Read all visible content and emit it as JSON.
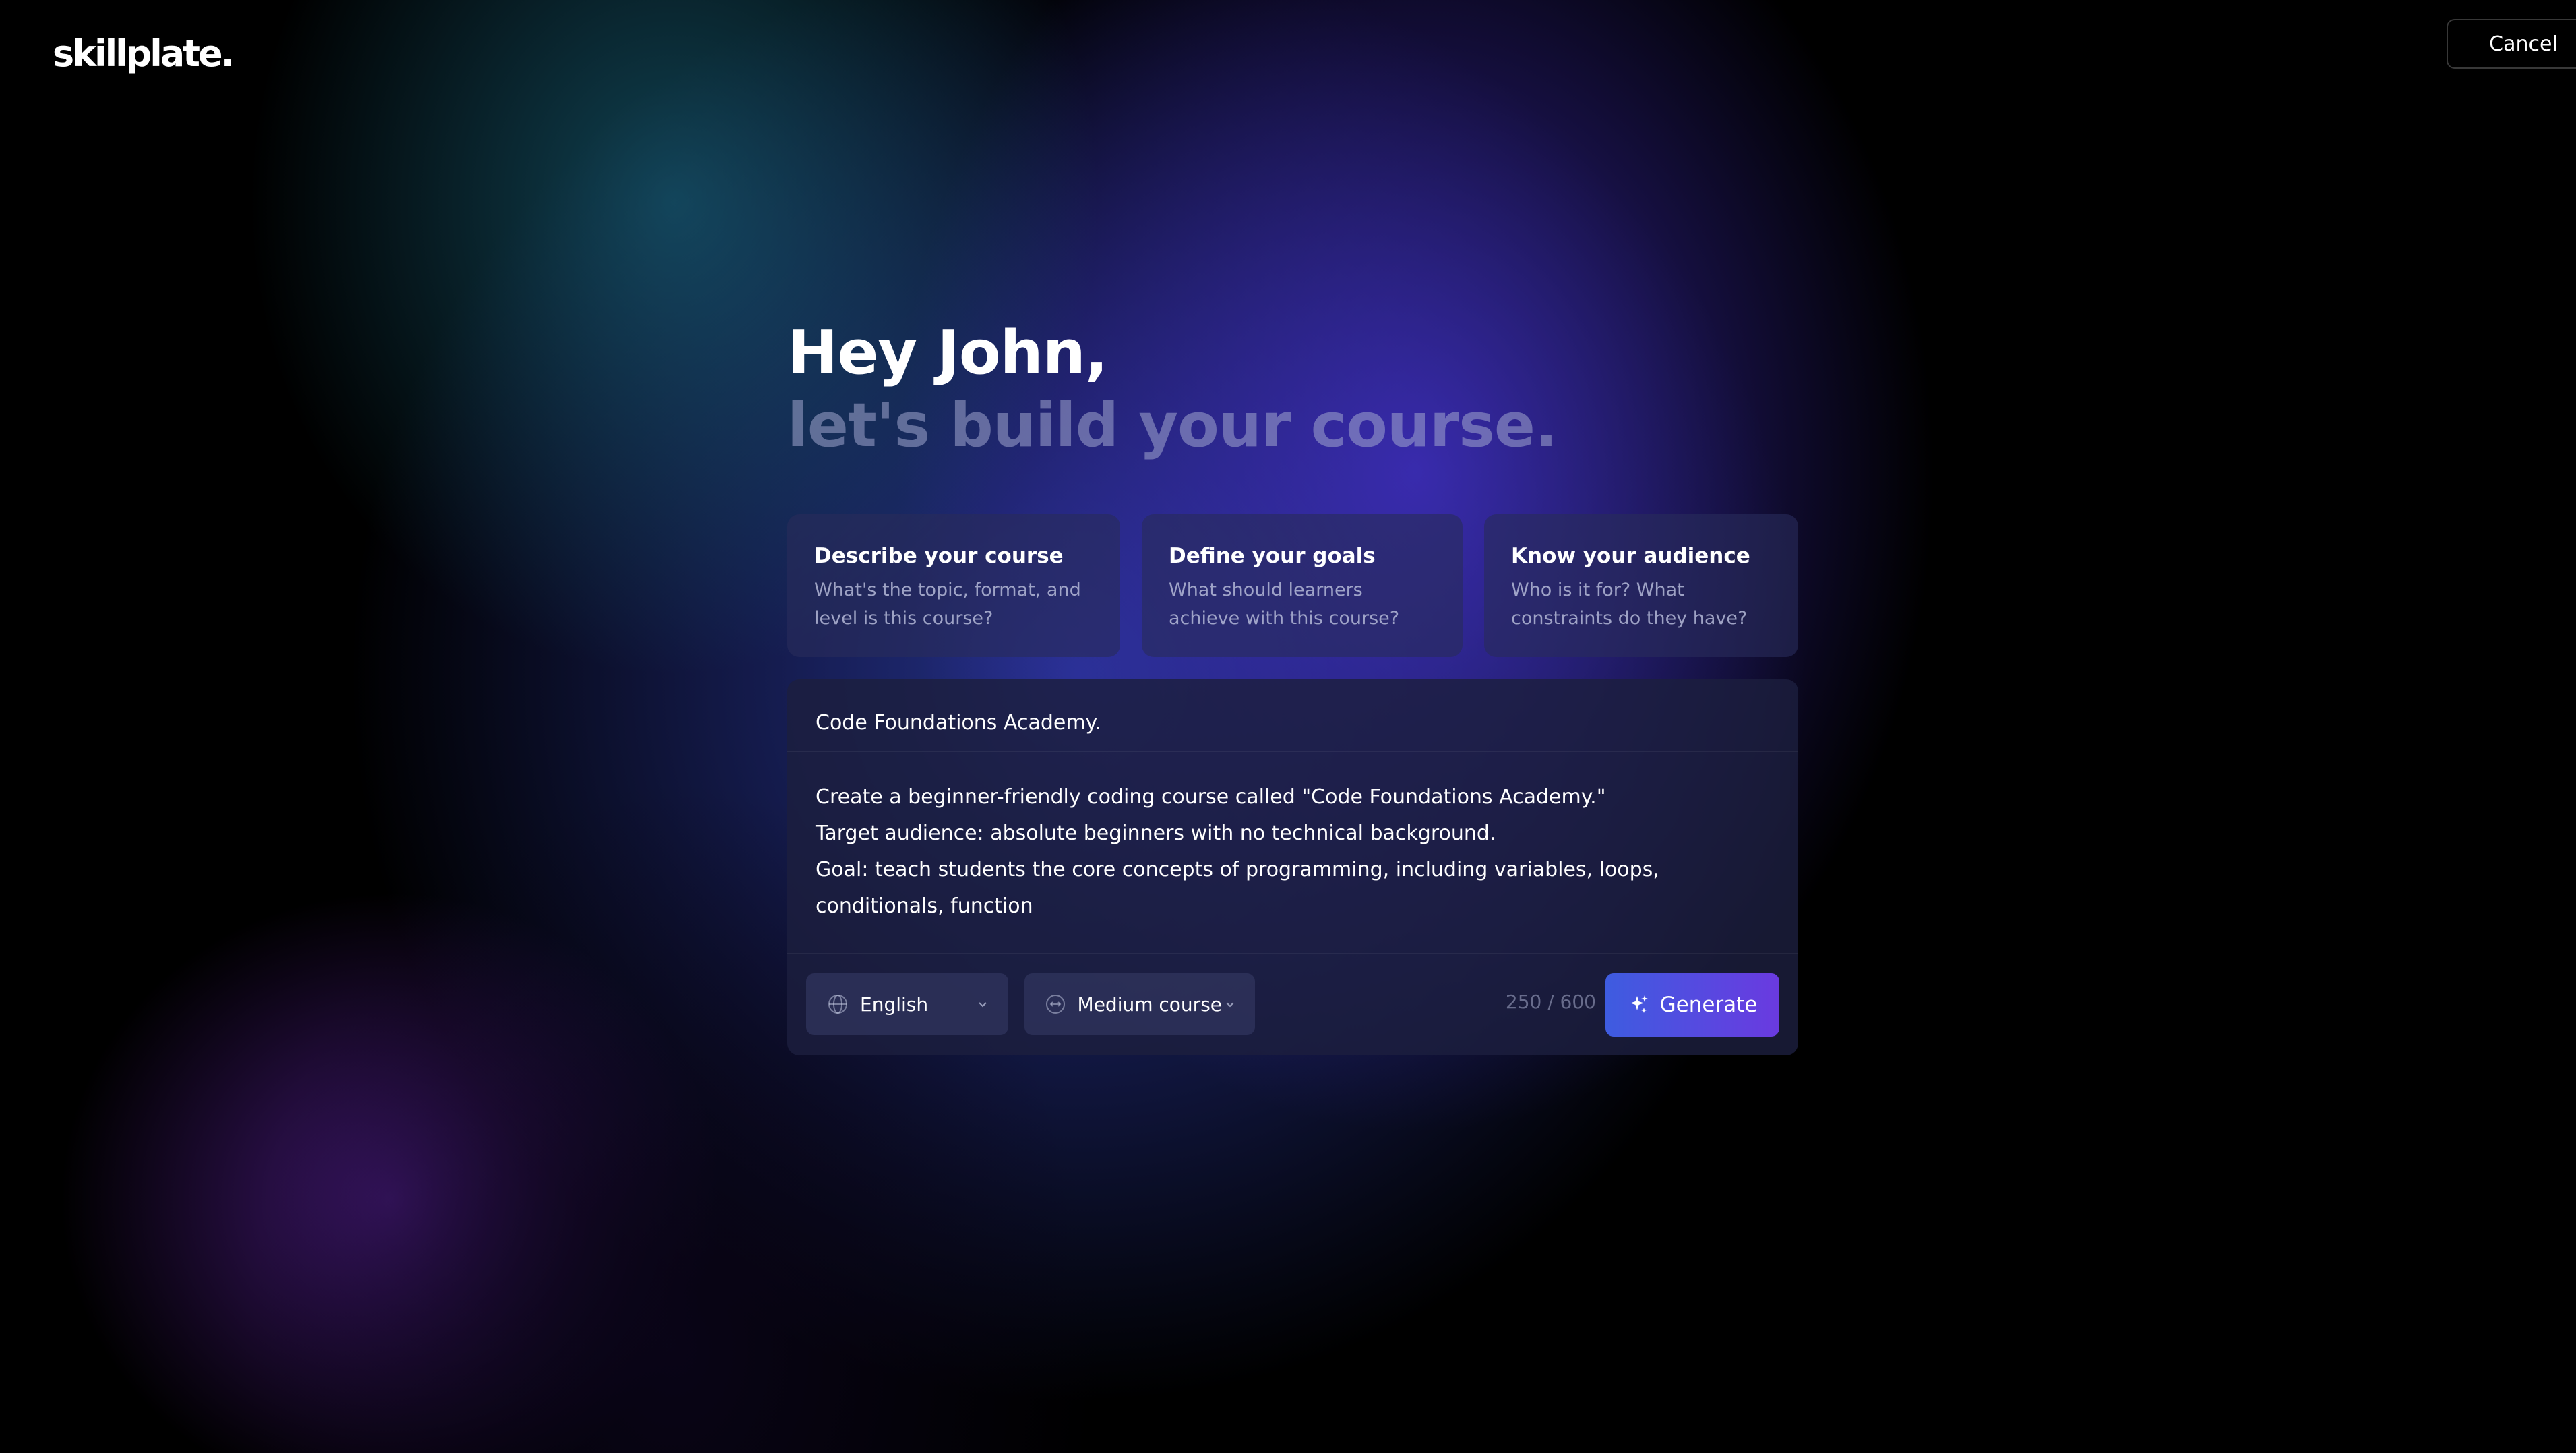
{
  "header": {
    "logo_text": "skillplate.",
    "cancel_label": "Cancel"
  },
  "hero": {
    "greeting": "Hey John,",
    "subtitle": "let's build your course."
  },
  "cards": [
    {
      "title": "Describe your course",
      "description": "What's the topic, format, and level is this course?"
    },
    {
      "title": "Define your goals",
      "description": "What should learners achieve with this course?"
    },
    {
      "title": "Know your audience",
      "description": "Who is it for? What constraints do they have?"
    }
  ],
  "composer": {
    "title_value": "Code Foundations Academy.",
    "prompt_lines": [
      "Create a beginner-friendly coding course called \"Code Foundations Academy.\"",
      "Target audience: absolute beginners with no technical background.",
      "Goal: teach students the core concepts of programming, including variables, loops,",
      "conditionals, function"
    ],
    "language": {
      "selected": "English",
      "icon": "globe-icon"
    },
    "length": {
      "selected": "Medium course",
      "icon": "length-icon"
    },
    "counter": "250 / 600",
    "generate_label": "Generate",
    "generate_icon": "sparkle-icon"
  },
  "colors": {
    "accent_start": "#3e5ce0",
    "accent_end": "#6a3ae0"
  }
}
